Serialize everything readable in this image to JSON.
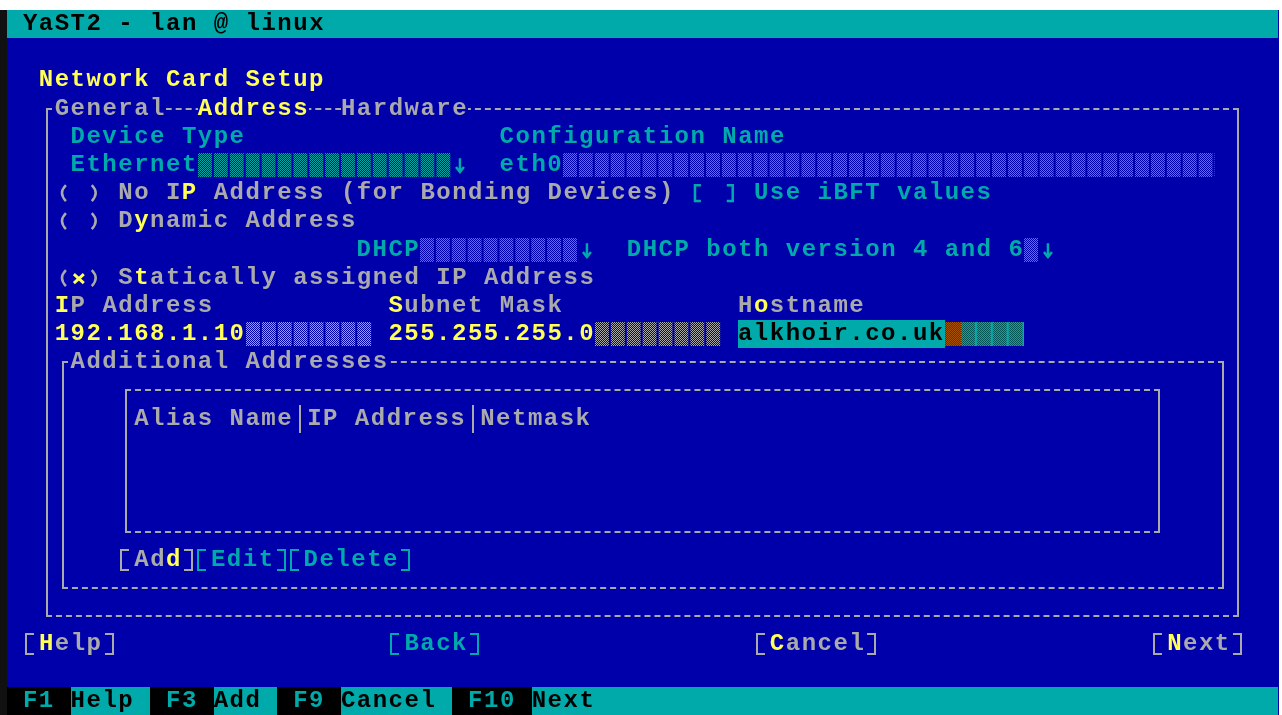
{
  "window": {
    "title": "YaST2 - lan @ linux"
  },
  "dialog_title": "Network Card Setup",
  "tabs": [
    {
      "label": "General",
      "selected": false
    },
    {
      "label": "Address",
      "selected": true
    },
    {
      "label": "Hardware",
      "selected": false
    }
  ],
  "device_type": {
    "label": "Device Type",
    "value": "Ethernet",
    "disabled": true
  },
  "configuration_name": {
    "label": "Configuration Name",
    "value": "eth0",
    "disabled": true
  },
  "address_modes": [
    {
      "label": "No I**P** Address (for Bonding Devices)",
      "selected": false
    },
    {
      "label": "D**y**namic Address",
      "selected": false
    },
    {
      "label": "S**t**atically assigned IP Address",
      "selected": true
    }
  ],
  "ibft": {
    "label": "Use iBFT values",
    "checked": false,
    "disabled": true
  },
  "dhcp_mode": {
    "value": "DHCP",
    "disabled": true
  },
  "dhcp_version": {
    "value": "DHCP both version 4 and 6",
    "disabled": true
  },
  "static_fields": [
    {
      "label": "**I**P Address",
      "value": "192.168.1.10",
      "focused": false
    },
    {
      "label": "**S**ubnet Mask",
      "value": "255.255.255.0",
      "focused": false
    },
    {
      "label": "H**o**stname",
      "value": "alkhoir.co.uk",
      "focused": true
    }
  ],
  "additional_addresses": {
    "title": "Additional Addresses",
    "columns": [
      "Alias Name",
      "IP Address",
      "Netmask"
    ],
    "buttons": [
      {
        "label": "Ad**d**",
        "disabled": false
      },
      {
        "label": "Edit",
        "disabled": true
      },
      {
        "label": "Delete",
        "disabled": true
      }
    ]
  },
  "buttons": [
    {
      "label": "**H**elp",
      "disabled": false
    },
    {
      "label": "Back",
      "disabled": true
    },
    {
      "label": "**C**ancel",
      "disabled": false
    },
    {
      "label": "**N**ext",
      "disabled": false
    }
  ],
  "function_keys": [
    {
      "key": "F1",
      "label": "Help"
    },
    {
      "key": "F3",
      "label": "Add"
    },
    {
      "key": "F9",
      "label": "Cancel"
    },
    {
      "key": "F10",
      "label": "Next"
    }
  ]
}
